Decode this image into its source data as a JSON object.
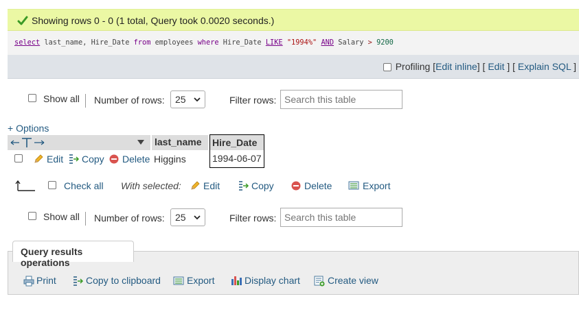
{
  "success": {
    "message": "Showing rows 0 - 0 (1 total, Query took 0.0020 seconds.)"
  },
  "query": {
    "tokens": [
      {
        "t": "select",
        "c": "kwu"
      },
      {
        "t": " last_name, Hire_Date ",
        "c": ""
      },
      {
        "t": "from",
        "c": "kw"
      },
      {
        "t": " employees ",
        "c": ""
      },
      {
        "t": "where",
        "c": "kw"
      },
      {
        "t": " Hire_Date ",
        "c": ""
      },
      {
        "t": "LIKE",
        "c": "kwu"
      },
      {
        "t": " ",
        "c": ""
      },
      {
        "t": "\"1994%\"",
        "c": "str"
      },
      {
        "t": " ",
        "c": ""
      },
      {
        "t": "AND",
        "c": "kwu"
      },
      {
        "t": " Salary ",
        "c": ""
      },
      {
        "t": ">",
        "c": "op"
      },
      {
        "t": " ",
        "c": ""
      },
      {
        "t": "9200",
        "c": "num"
      }
    ]
  },
  "profiling": {
    "label": "Profiling",
    "edit_inline": "Edit inline",
    "edit": "Edit",
    "explain": "Explain SQL",
    "open_bracket": "[",
    "close_bracket": "]"
  },
  "nav_top": {
    "show_all": "Show all",
    "rows_label": "Number of rows:",
    "rows_value": "25",
    "filter_label": "Filter rows:",
    "filter_placeholder": "Search this table"
  },
  "nav_bottom": {
    "show_all": "Show all",
    "rows_label": "Number of rows:",
    "rows_value": "25",
    "filter_label": "Filter rows:",
    "filter_placeholder": "Search this table"
  },
  "options_link": "+ Options",
  "table": {
    "columns": [
      "last_name",
      "Hire_Date"
    ],
    "row": {
      "edit": "Edit",
      "copy": "Copy",
      "delete": "Delete",
      "last_name": "Higgins",
      "hire_date": "1994-06-07"
    }
  },
  "bulk": {
    "check_all": "Check all",
    "with_selected": "With selected:",
    "edit": "Edit",
    "copy": "Copy",
    "delete": "Delete",
    "export": "Export"
  },
  "ops": {
    "title": "Query results operations",
    "print": "Print",
    "copy_clipboard": "Copy to clipboard",
    "export": "Export",
    "display_chart": "Display chart",
    "create_view": "Create view"
  },
  "colors": {
    "success_bg": "#ebf8a4",
    "link": "#235a81",
    "header_bg": "#dddddd",
    "delete_red": "#d9534f"
  }
}
